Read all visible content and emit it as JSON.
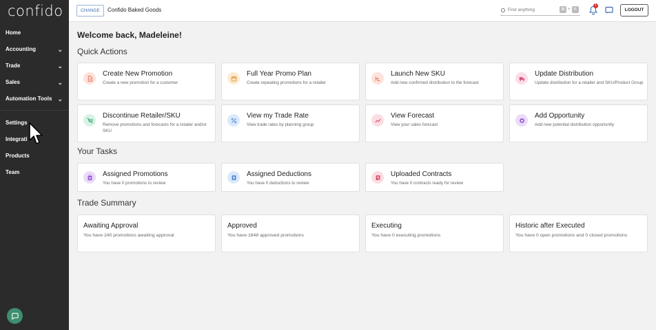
{
  "sidebar": {
    "logo": "confido",
    "items": [
      {
        "label": "Home",
        "chevron": false
      },
      {
        "label": "Accounting",
        "chevron": true
      },
      {
        "label": "Trade",
        "chevron": true
      },
      {
        "label": "Sales",
        "chevron": true
      },
      {
        "label": "Automation Tools",
        "chevron": true
      }
    ],
    "items2": [
      {
        "label": "Settings"
      },
      {
        "label": "Integrati"
      },
      {
        "label": "Products"
      },
      {
        "label": "Team"
      }
    ]
  },
  "topbar": {
    "change_label": "CHANGE",
    "company": "Confido Baked Goods",
    "search_placeholder": "Find anything",
    "kbd1": "⌘",
    "kbd_plus": "+",
    "kbd2": "K",
    "notif_count": "1",
    "logout_label": "LOGOUT"
  },
  "main": {
    "welcome": "Welcome back, Madeleine!",
    "quick_actions_title": "Quick Actions",
    "your_tasks_title": "Your Tasks",
    "trade_summary_title": "Trade Summary",
    "quick_actions": [
      {
        "title": "Create New Promotion",
        "desc": "Create a new promotion for a customer",
        "icon": "doc-icon",
        "color": "#fde3dc",
        "fg": "#e2725b"
      },
      {
        "title": "Full Year Promo Plan",
        "desc": "Create repeating promotions for a retailer",
        "icon": "calendar-icon",
        "color": "#fdebd3",
        "fg": "#e0953a"
      },
      {
        "title": "Launch New SKU",
        "desc": "Add new confirmed distribution to the forecast",
        "icon": "sku-icon",
        "color": "#fde3dc",
        "fg": "#e2725b"
      },
      {
        "title": "Update Distribution",
        "desc": "Update distribution for a retailer and SKU/Product Group",
        "icon": "truck-icon",
        "color": "#fbdde8",
        "fg": "#d9487c"
      },
      {
        "title": "Discontinue Retailer/SKU",
        "desc": "Remove promotions and forecasts for a retailer and/or SKU",
        "icon": "cart-off-icon",
        "color": "#d9f2e6",
        "fg": "#3aa876"
      },
      {
        "title": "View my Trade Rate",
        "desc": "View trade rates by planning group",
        "icon": "percent-icon",
        "color": "#dbe9fb",
        "fg": "#4a86d4"
      },
      {
        "title": "View Forecast",
        "desc": "View your sales forecast",
        "icon": "trend-icon",
        "color": "#fbdde3",
        "fg": "#d94a64"
      },
      {
        "title": "Add Opportunity",
        "desc": "Add new potential distribution opportunity",
        "icon": "star-icon",
        "color": "#eadcf7",
        "fg": "#9a5bd6"
      }
    ],
    "tasks": [
      {
        "title": "Assigned Promotions",
        "desc": "You have 0 promotions to review",
        "icon": "clipboard-icon",
        "color": "#eadcf7",
        "fg": "#9a5bd6"
      },
      {
        "title": "Assigned Deductions",
        "desc": "You have 0 deductions to review",
        "icon": "list-icon",
        "color": "#dbe9fb",
        "fg": "#4a86d4"
      },
      {
        "title": "Uploaded Contracts",
        "desc": "You have 0 contracts ready for review",
        "icon": "contract-icon",
        "color": "#fbdde3",
        "fg": "#d94a64"
      }
    ],
    "summary": [
      {
        "title": "Awaiting Approval",
        "desc": "You have 240 promotions awaiting approval"
      },
      {
        "title": "Approved",
        "desc": "You have 1648 approved promotions"
      },
      {
        "title": "Executing",
        "desc": "You have 0 executing promotions"
      },
      {
        "title": "Historic after Executed",
        "desc": "You have 0 open promotions and 0 closed promotions"
      }
    ]
  }
}
